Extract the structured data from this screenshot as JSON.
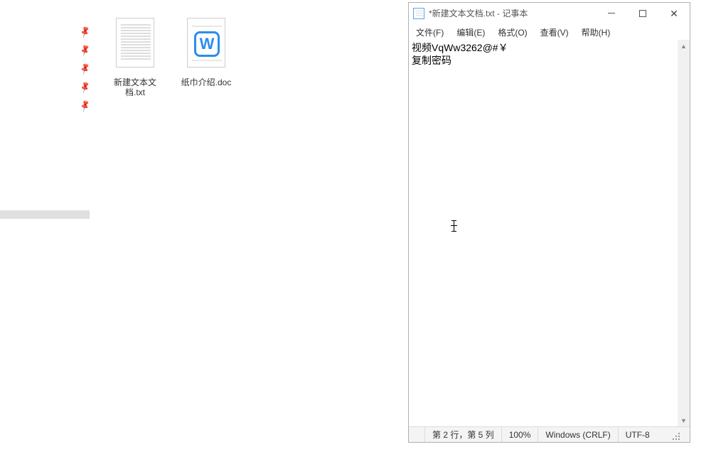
{
  "desktop": {
    "icons": [
      {
        "label": "新建文本文档.txt",
        "kind": "txt"
      },
      {
        "label": "纸巾介绍.doc",
        "kind": "doc",
        "badge": "W"
      }
    ]
  },
  "notepad": {
    "title": "*新建文本文档.txt - 记事本",
    "menu": [
      "文件(F)",
      "编辑(E)",
      "格式(O)",
      "查看(V)",
      "帮助(H)"
    ],
    "content_line1": "视频VqWw3262@#￥",
    "content_line2": "复制密码",
    "status": {
      "position": "第 2 行，第 5 列",
      "zoom": "100%",
      "eol": "Windows (CRLF)",
      "encoding": "UTF-8"
    }
  }
}
